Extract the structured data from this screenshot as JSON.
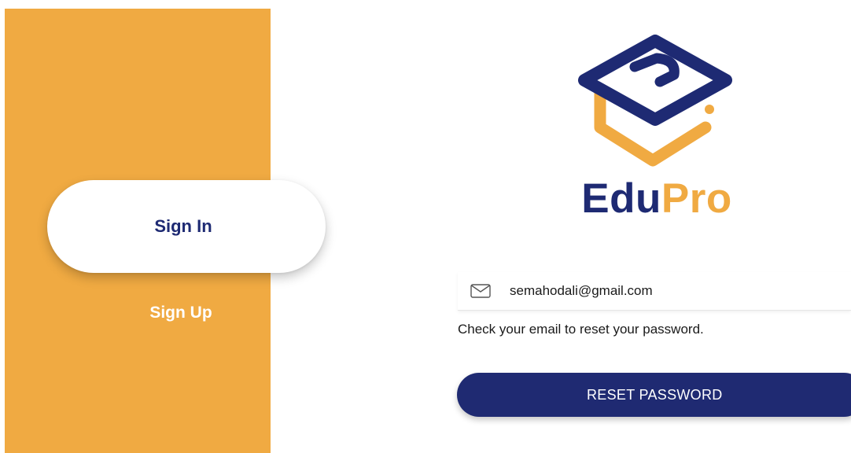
{
  "sidebar": {
    "signin_label": "Sign In",
    "signup_label": "Sign Up",
    "background_color": "#F0AA42"
  },
  "logo": {
    "icon": "graduation-cap-logo",
    "brand_part1": "Edu",
    "brand_part2": "Pro",
    "primary_color": "#1E2A73",
    "accent_color": "#F0AA42"
  },
  "form": {
    "email_icon": "envelope-icon",
    "email_value": "semahodali@gmail.com",
    "helper_text": "Check your email to reset your password.",
    "reset_button_label": "RESET PASSWORD"
  }
}
